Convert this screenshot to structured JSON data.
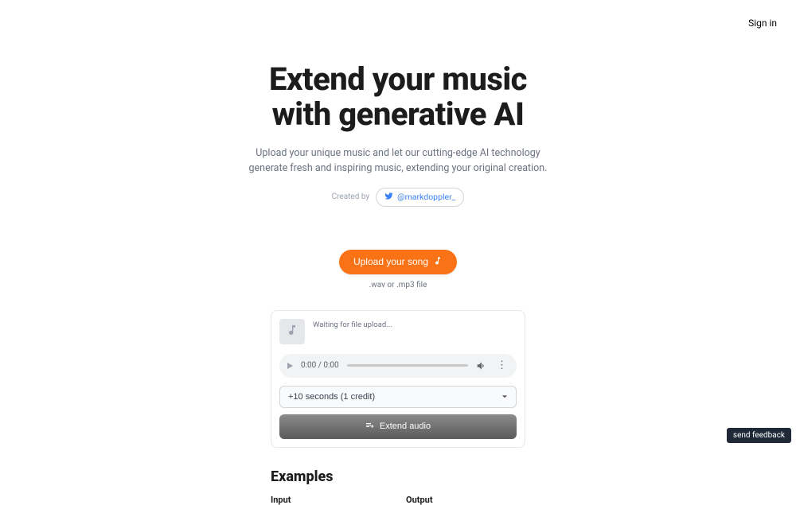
{
  "nav": {
    "signin": "Sign in"
  },
  "hero": {
    "title_line1": "Extend your music",
    "title_line2": "with generative AI",
    "subtitle": "Upload your unique music and let our cutting-edge AI technology generate fresh and inspiring music, extending your original creation.",
    "created_by_label": "Created by",
    "twitter_handle": "@markdoppler_"
  },
  "upload": {
    "button_label": "Upload your song",
    "hint": ".wav or .mp3 file"
  },
  "player": {
    "waiting_text": "Waiting for file upload...",
    "time": "0:00 / 0:00"
  },
  "controls": {
    "duration_selected": "+10 seconds (1 credit)",
    "extend_label": "Extend audio"
  },
  "examples": {
    "heading": "Examples",
    "input_label": "Input",
    "output_label": "Output"
  },
  "feedback": {
    "label": "send feedback"
  }
}
